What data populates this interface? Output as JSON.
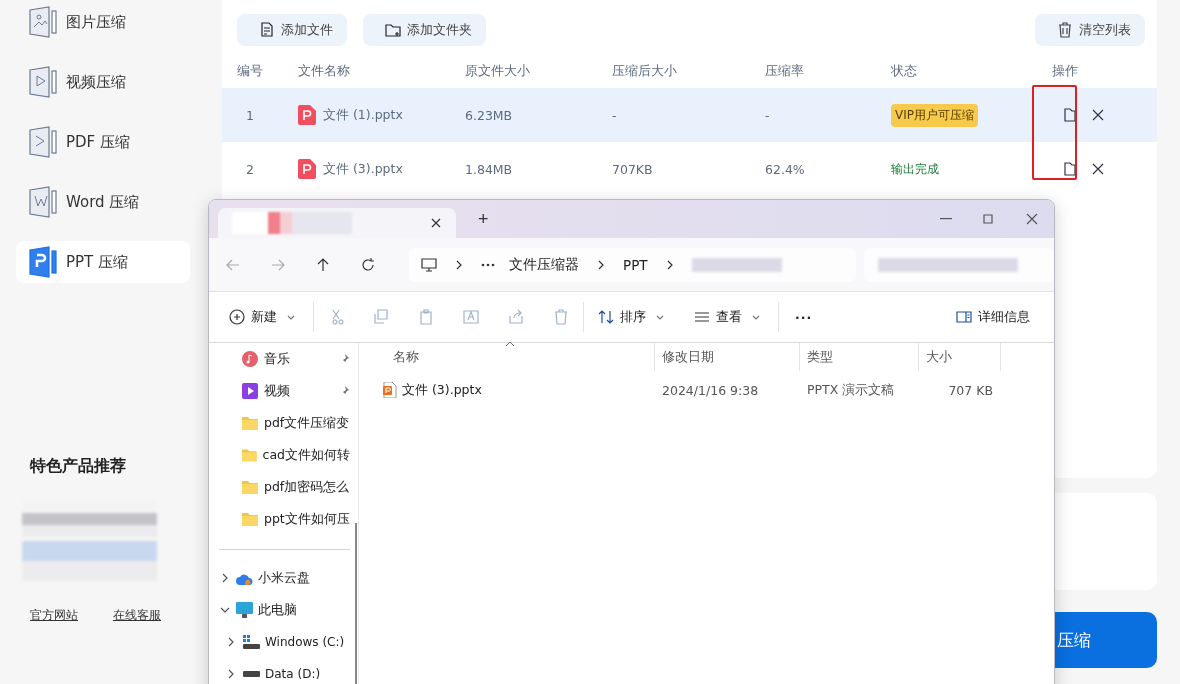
{
  "sidebar": {
    "items": [
      {
        "label": "图片压缩",
        "selected": false
      },
      {
        "label": "视频压缩",
        "selected": false
      },
      {
        "label": "PDF 压缩",
        "selected": false
      },
      {
        "label": "Word 压缩",
        "selected": false
      },
      {
        "label": "PPT 压缩",
        "selected": true
      }
    ],
    "promo_title": "特色产品推荐",
    "links": [
      "官方网站",
      "在线客服"
    ]
  },
  "toolbar": {
    "left": [
      {
        "label": "添加文件"
      },
      {
        "label": "添加文件夹"
      }
    ],
    "right": {
      "label": "清空列表"
    }
  },
  "table": {
    "columns": [
      "编号",
      "文件名称",
      "原文件大小",
      "压缩后大小",
      "压缩率",
      "状态",
      "操作"
    ],
    "rows": [
      {
        "no": "1",
        "name": "文件 (1).pptx",
        "original": "6.23MB",
        "compressed": "-",
        "ratio": "-",
        "status": {
          "kind": "badge",
          "text": "VIP用户可压缩"
        },
        "selected": true
      },
      {
        "no": "2",
        "name": "文件 (3).pptx",
        "original": "1.84MB",
        "compressed": "707KB",
        "ratio": "62.4%",
        "status": {
          "kind": "done",
          "text": "输出完成"
        },
        "selected": false
      }
    ]
  },
  "start_button": "压缩",
  "explorer": {
    "new_tab": "+",
    "breadcrumb": [
      "文件压缩器",
      "PPT"
    ],
    "commands": {
      "new": "新建",
      "sort": "排序",
      "view": "查看",
      "more": "···",
      "details": "详细信息"
    },
    "nav": [
      {
        "label": "音乐",
        "kind": "music",
        "pinned": true
      },
      {
        "label": "视频",
        "kind": "video",
        "pinned": true
      },
      {
        "label": "pdf文件压缩变",
        "kind": "folder",
        "pinned": false
      },
      {
        "label": "cad文件如何转",
        "kind": "folder",
        "pinned": false
      },
      {
        "label": "pdf加密码怎么",
        "kind": "folder",
        "pinned": false
      },
      {
        "label": "ppt文件如何压",
        "kind": "folder",
        "pinned": false
      }
    ],
    "tree": [
      {
        "label": "小米云盘",
        "kind": "cloud",
        "expanded": false
      },
      {
        "label": "此电脑",
        "kind": "pc",
        "expanded": true,
        "children": [
          {
            "label": "Windows (C:)",
            "kind": "system-drive",
            "expanded": false
          },
          {
            "label": "Data (D:)",
            "kind": "drive",
            "expanded": false
          }
        ]
      }
    ],
    "columns": [
      "名称",
      "修改日期",
      "类型",
      "大小"
    ],
    "files": [
      {
        "name": "文件 (3).pptx",
        "modified": "2024/1/16 9:38",
        "type": "PPTX 演示文稿",
        "size": "707 KB"
      }
    ]
  }
}
